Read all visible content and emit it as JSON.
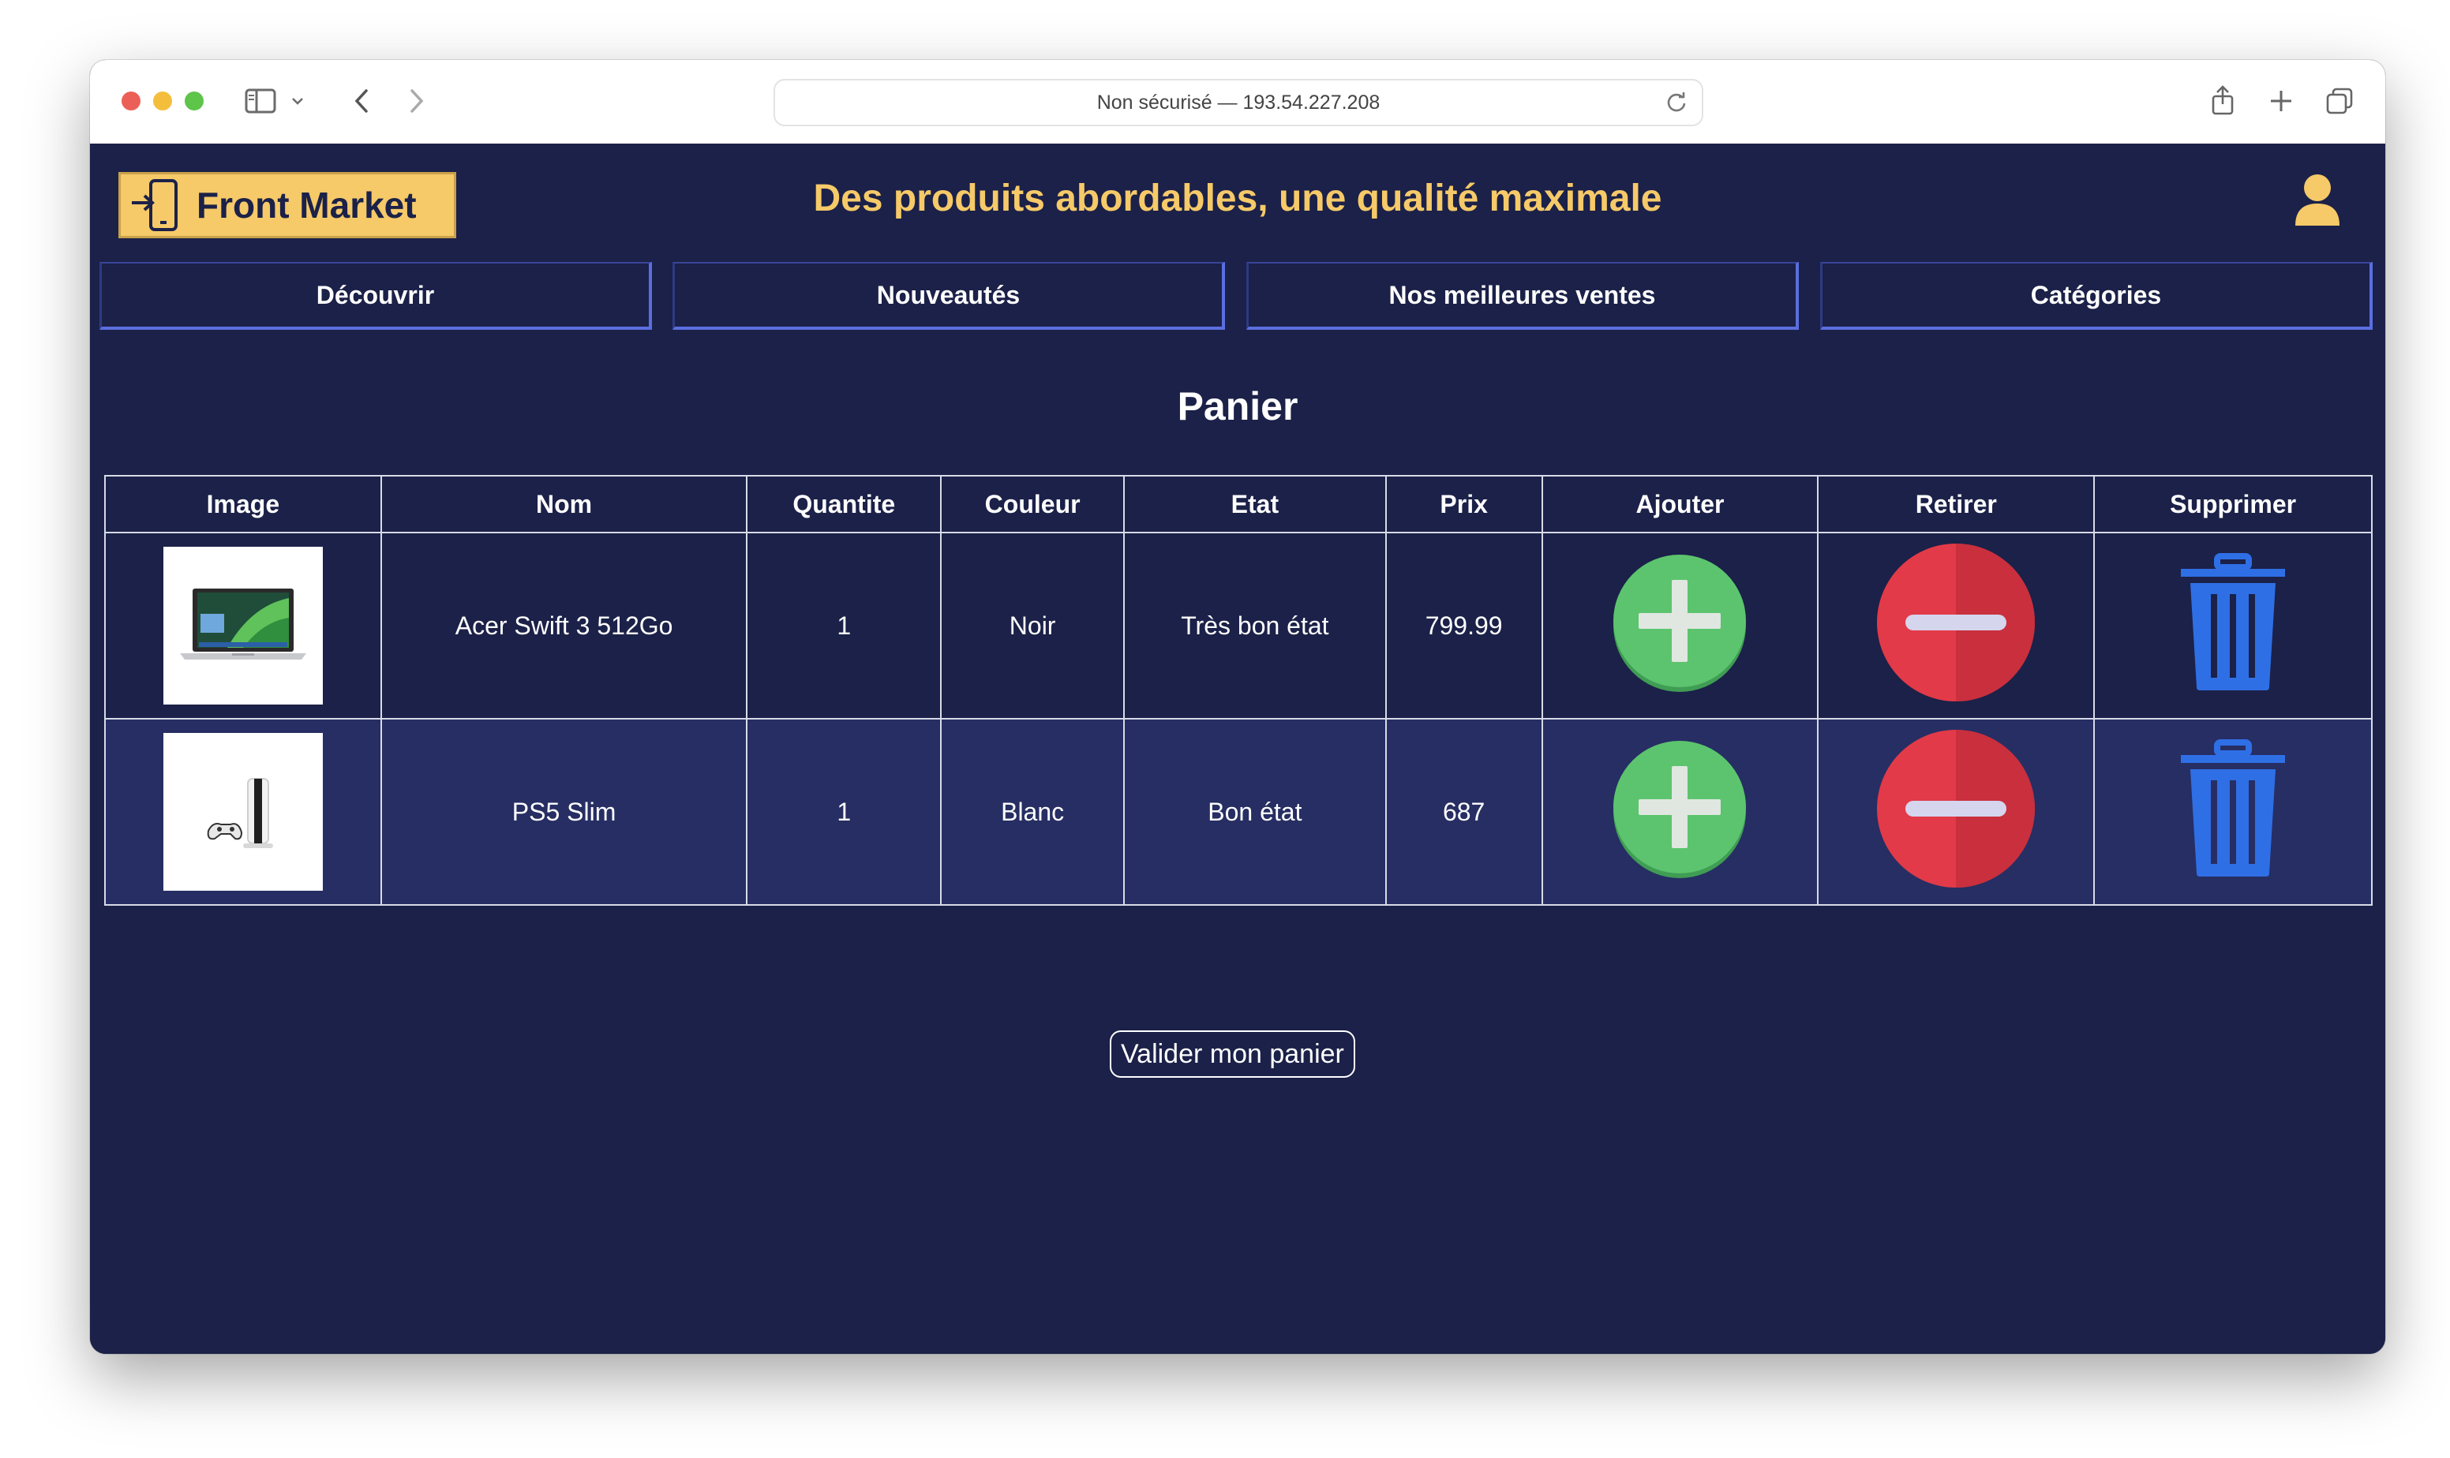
{
  "browser": {
    "url_text": "Non sécurisé — 193.54.227.208"
  },
  "header": {
    "brand": "Front Market",
    "tagline": "Des produits abordables, une qualité maximale"
  },
  "nav": {
    "items": [
      {
        "label": "Découvrir"
      },
      {
        "label": "Nouveautés"
      },
      {
        "label": "Nos meilleures ventes"
      },
      {
        "label": "Catégories"
      }
    ]
  },
  "cart": {
    "title": "Panier",
    "columns": [
      "Image",
      "Nom",
      "Quantite",
      "Couleur",
      "Etat",
      "Prix",
      "Ajouter",
      "Retirer",
      "Supprimer"
    ],
    "rows": [
      {
        "image_icon": "laptop-image",
        "name": "Acer Swift 3 512Go",
        "quantity": "1",
        "color": "Noir",
        "condition": "Très bon état",
        "price": "799.99"
      },
      {
        "image_icon": "console-image",
        "name": "PS5 Slim",
        "quantity": "1",
        "color": "Blanc",
        "condition": "Bon état",
        "price": "687"
      }
    ],
    "validate_label": "Valider mon panier"
  },
  "colors": {
    "page_bg": "#1b2148",
    "accent_yellow": "#f6c969",
    "add_green": "#5cc46e",
    "remove_red": "#e23a48",
    "trash_blue": "#2f6fe6"
  }
}
